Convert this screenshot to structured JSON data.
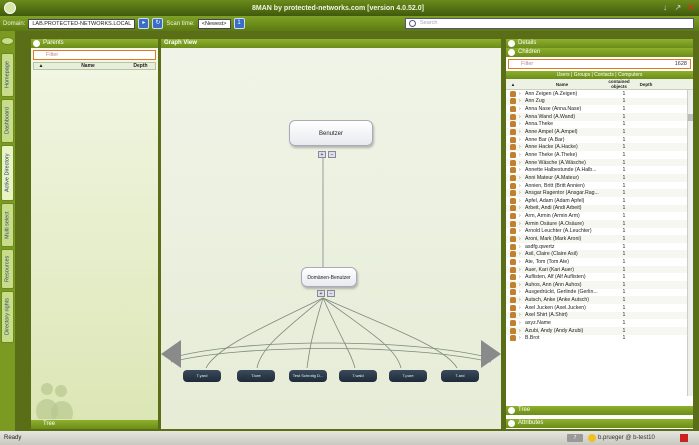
{
  "app": {
    "title": "8MAN by protected-networks.com [version 4.0.52.0]"
  },
  "toolbar": {
    "domain_label": "Domain:",
    "domain_value": "LAB.PROTECTED-NETWORKS.LOCAL",
    "scan_label": "Scan time:",
    "scan_value": "<Newest>",
    "scan_num": "1",
    "search_placeholder": "Search"
  },
  "vtabs": [
    "Homepage",
    "Dashboard",
    "Active Directory",
    "Multi select",
    "Resources",
    "Directory rights"
  ],
  "left_panel": {
    "title": "Parents",
    "filter_placeholder": "Filter",
    "columns": [
      "Name",
      "Depth"
    ],
    "footer": "Tree"
  },
  "graph": {
    "title": "Graph View",
    "root_node": "Benutzer",
    "mid_node": "Domänen-Benutzer",
    "leaves": [
      "T.yard",
      "T.kee",
      "Test Schrotig D...",
      "T.wald",
      "T.pure",
      "T.ard"
    ]
  },
  "right_panel": {
    "details_title": "Details",
    "children_title": "Children",
    "filter_placeholder": "Filter",
    "count": "1628",
    "types": "Users | Groups | Contacts | Computers",
    "columns": [
      "Name",
      "contained objects",
      "Depth"
    ],
    "rows": [
      {
        "name": "Ann Zeigen (A.Zeigen)",
        "count": "1"
      },
      {
        "name": "Ann Zug",
        "count": "1"
      },
      {
        "name": "Anna Nase (Anna.Nase)",
        "count": "1"
      },
      {
        "name": "Anna Wand (A.Wand)",
        "count": "1"
      },
      {
        "name": "Anna.Theke",
        "count": "1"
      },
      {
        "name": "Anne Ampel (A.Ampel)",
        "count": "1"
      },
      {
        "name": "Anne Bar (A.Bar)",
        "count": "1"
      },
      {
        "name": "Anne Hacke (A.Hacke)",
        "count": "1"
      },
      {
        "name": "Anne Theke (A.Theke)",
        "count": "1"
      },
      {
        "name": "Anne Wäsche (A.Wäsche)",
        "count": "1"
      },
      {
        "name": "Annette Halbestunde (A.Halb...",
        "count": "1"
      },
      {
        "name": "Anni Mateur (A.Mateur)",
        "count": "1"
      },
      {
        "name": "Annien, Britt (Britt Annien)",
        "count": "1"
      },
      {
        "name": "Ansgar Ragentor (Ansgar.Rag...",
        "count": "1"
      },
      {
        "name": "Apfel, Adam (Adam Apfel)",
        "count": "1"
      },
      {
        "name": "Arbeit, Andi (Andi Arbeit)",
        "count": "1"
      },
      {
        "name": "Arm, Armin (Armin Arm)",
        "count": "1"
      },
      {
        "name": "Armin Osäure (A.Osäure)",
        "count": "1"
      },
      {
        "name": "Arnold Leuchter (A.Leuchter)",
        "count": "1"
      },
      {
        "name": "Aroni, Mark (Mark Aroni)",
        "count": "1"
      },
      {
        "name": "asdfg.qwertz",
        "count": "1"
      },
      {
        "name": "Asil, Claire (Claire Asil)",
        "count": "1"
      },
      {
        "name": "Ate, Tom (Tom Ate)",
        "count": "1"
      },
      {
        "name": "Auer, Kari (Kari Auer)",
        "count": "1"
      },
      {
        "name": "Auflisten, Alf (Alf Auflisten)",
        "count": "1"
      },
      {
        "name": "Auhos, Ann (Ann Auhos)",
        "count": "1"
      },
      {
        "name": "Ausgedrückt, Gerlinde (Gerlin...",
        "count": "1"
      },
      {
        "name": "Autsch, Anke (Anke Autsch)",
        "count": "1"
      },
      {
        "name": "Axel Jucken (Axel.Jucken)",
        "count": "1"
      },
      {
        "name": "Axel Shirt (A.Shirt)",
        "count": "1"
      },
      {
        "name": "axyz.Name",
        "count": "1"
      },
      {
        "name": "Azubi, Andy (Andy Azubi)",
        "count": "1"
      },
      {
        "name": "B.Brot",
        "count": "1"
      }
    ],
    "tree_footer": "Tree",
    "attributes_footer": "Attributes"
  },
  "status": {
    "text": "Ready",
    "badge": "7",
    "user": "b.prueger @ b-test10"
  }
}
